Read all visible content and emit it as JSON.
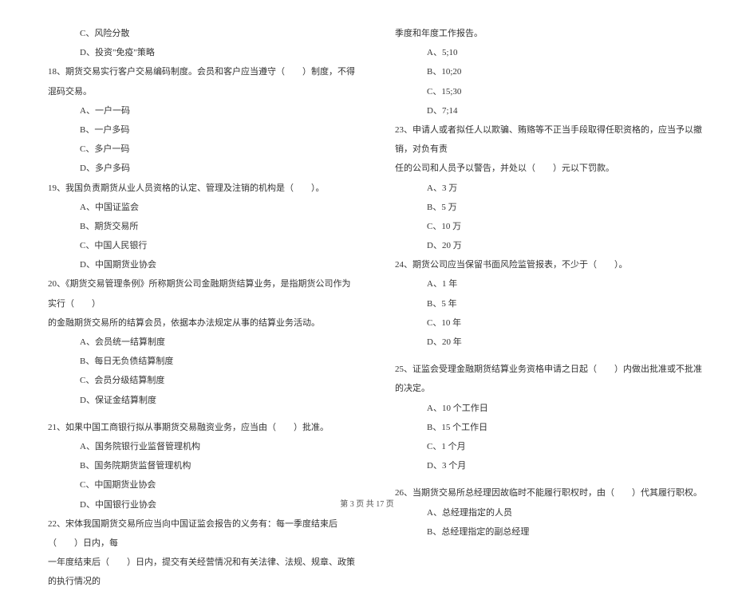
{
  "left_column": {
    "q17_opt_c": "C、风险分散",
    "q17_opt_d": "D、投资\"免疫\"策略",
    "q18": "18、期货交易实行客户交易编码制度。会员和客户应当遵守（　　）制度，不得混码交易。",
    "q18_a": "A、一户一码",
    "q18_b": "B、一户多码",
    "q18_c": "C、多户一码",
    "q18_d": "D、多户多码",
    "q19": "19、我国负责期货从业人员资格的认定、管理及注销的机构是（　　）。",
    "q19_a": "A、中国证监会",
    "q19_b": "B、期货交易所",
    "q19_c": "C、中国人民银行",
    "q19_d": "D、中国期货业协会",
    "q20_l1": "20、《期货交易管理条例》所称期货公司金融期货结算业务，是指期货公司作为实行（　　）",
    "q20_l2": "的金融期货交易所的结算会员，依据本办法规定从事的结算业务活动。",
    "q20_a": "A、会员统一结算制度",
    "q20_b": "B、每日无负债结算制度",
    "q20_c": "C、会员分级结算制度",
    "q20_d": "D、保证金结算制度",
    "q21": "21、如果中国工商银行拟从事期货交易融资业务，应当由（　　）批准。",
    "q21_a": "A、国务院银行业监督管理机构",
    "q21_b": "B、国务院期货监督管理机构",
    "q21_c": "C、中国期货业协会",
    "q21_d": "D、中国银行业协会",
    "q22_l1": "22、宋体我国期货交易所应当向中国证监会报告的义务有：每一季度结束后（　　）日内，每",
    "q22_l2": "一年度结束后（　　）日内，提交有关经营情况和有关法律、法规、规章、政策的执行情况的"
  },
  "right_column": {
    "q22_cont": "季度和年度工作报告。",
    "q22_a": "A、5;10",
    "q22_b": "B、10;20",
    "q22_c": "C、15;30",
    "q22_d": "D、7;14",
    "q23_l1": "23、申请人或者拟任人以欺骗、贿赂等不正当手段取得任职资格的，应当予以撤销，对负有责",
    "q23_l2": "任的公司和人员予以警告，并处以（　　）元以下罚款。",
    "q23_a": "A、3 万",
    "q23_b": "B、5 万",
    "q23_c": "C、10 万",
    "q23_d": "D、20 万",
    "q24": "24、期货公司应当保留书面风险监管报表，不少于（　　）。",
    "q24_a": "A、1 年",
    "q24_b": "B、5 年",
    "q24_c": "C、10 年",
    "q24_d": "D、20 年",
    "q25": "25、证监会受理金融期货结算业务资格申请之日起（　　）内做出批准或不批准的决定。",
    "q25_a": "A、10 个工作日",
    "q25_b": "B、15 个工作日",
    "q25_c": "C、1 个月",
    "q25_d": "D、3 个月",
    "q26": "26、当期货交易所总经理因故临时不能履行职权时，由（　　）代其履行职权。",
    "q26_a": "A、总经理指定的人员",
    "q26_b": "B、总经理指定的副总经理"
  },
  "footer": "第 3 页 共 17 页"
}
